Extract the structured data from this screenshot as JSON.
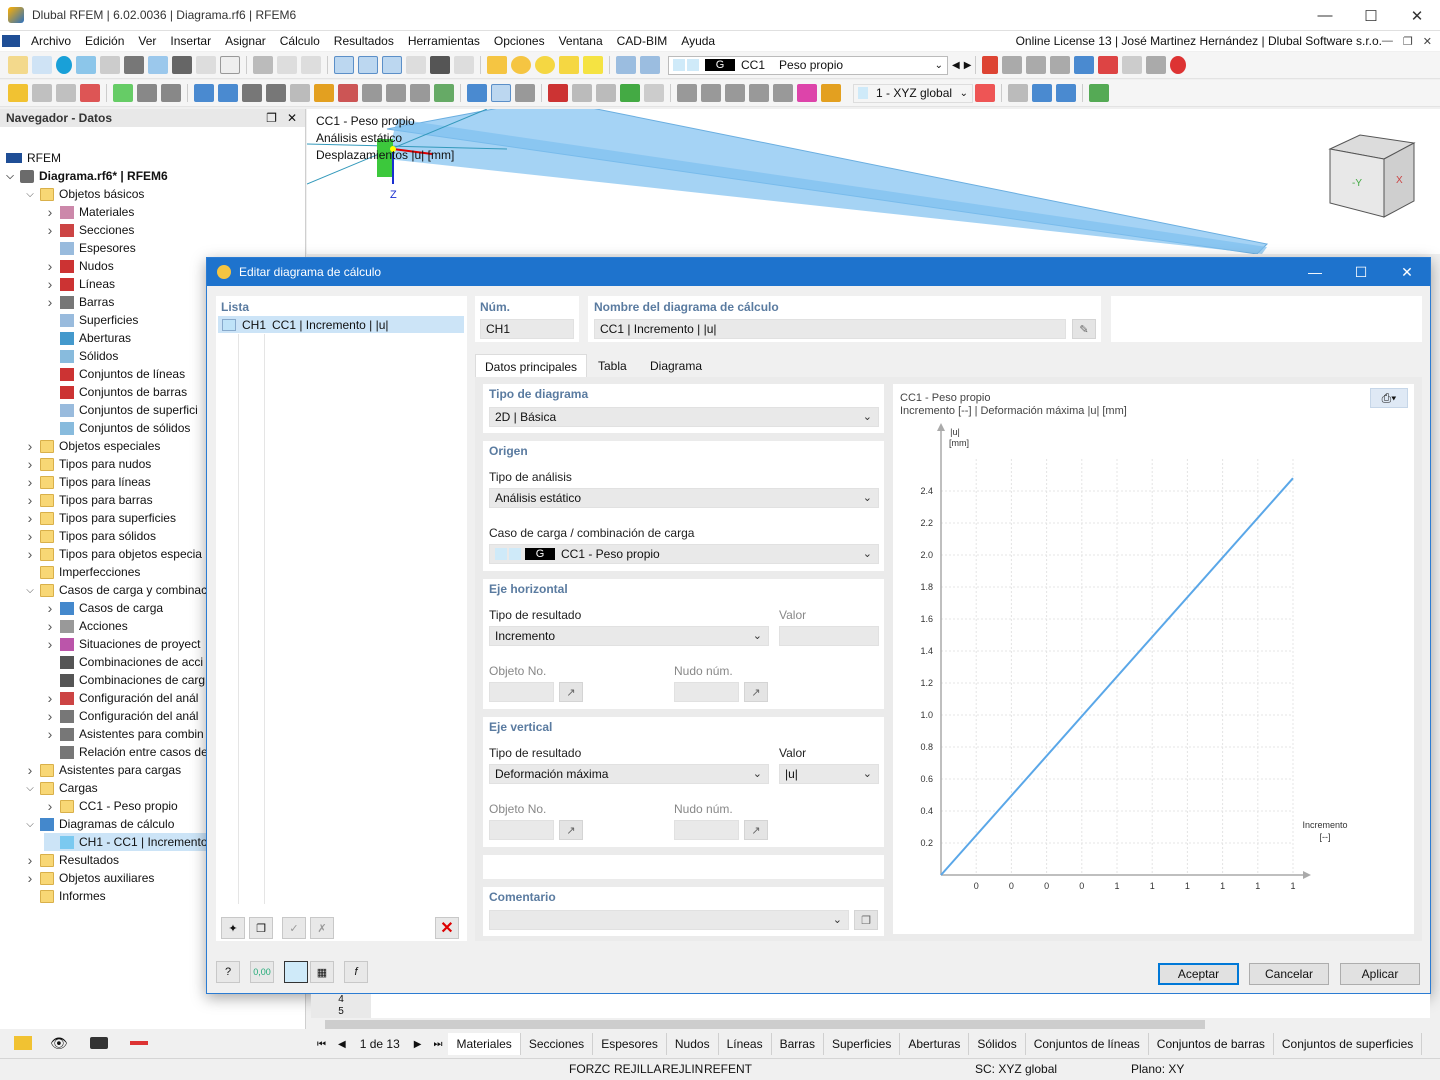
{
  "app": {
    "title": "Dlubal RFEM | 6.02.0036 | Diagrama.rf6 | RFEM6"
  },
  "menu": {
    "items": [
      "Archivo",
      "Edición",
      "Ver",
      "Insertar",
      "Asignar",
      "Cálculo",
      "Resultados",
      "Herramientas",
      "Opciones",
      "Ventana",
      "CAD-BIM",
      "Ayuda"
    ],
    "license": "Online License 13 | José Martinez Hernández | Dlubal Software s.r.o."
  },
  "toolbar": {
    "load_case_tag": "G",
    "load_case_id": "CC1",
    "load_case_name": "Peso propio",
    "coord_system": "1 - XYZ global"
  },
  "navigator": {
    "title": "Navegador - Datos",
    "root": "RFEM",
    "file": "Diagrama.rf6* | RFEM6",
    "items": [
      "Objetos básicos",
      "Materiales",
      "Secciones",
      "Espesores",
      "Nudos",
      "Líneas",
      "Barras",
      "Superficies",
      "Aberturas",
      "Sólidos",
      "Conjuntos de líneas",
      "Conjuntos de barras",
      "Conjuntos de superfici",
      "Conjuntos de sólidos",
      "Objetos especiales",
      "Tipos para nudos",
      "Tipos para líneas",
      "Tipos para barras",
      "Tipos para superficies",
      "Tipos para sólidos",
      "Tipos para objetos especia",
      "Imperfecciones",
      "Casos de carga y combinac",
      "Casos de carga",
      "Acciones",
      "Situaciones de proyect",
      "Combinaciones de acci",
      "Combinaciones de carg",
      "Configuración del anál",
      "Configuración del anál",
      "Asistentes para combin",
      "Relación entre casos de",
      "Asistentes para cargas",
      "Cargas",
      "CC1 - Peso propio",
      "Diagramas de cálculo",
      "CH1 - CC1 | Incremento",
      "Resultados",
      "Objetos auxiliares",
      "Informes"
    ]
  },
  "viewport": {
    "info": [
      "CC1 - Peso propio",
      "Análisis estático",
      "Desplazamientos |u| [mm]"
    ],
    "axis_z": "Z"
  },
  "dialog": {
    "title": "Editar diagrama de cálculo",
    "list_label": "Lista",
    "list_items": [
      {
        "id": "CH1",
        "name": "CC1 | Incremento | |u|"
      }
    ],
    "num_label": "Núm.",
    "num_value": "CH1",
    "name_label": "Nombre del diagrama de cálculo",
    "name_value": "CC1 | Incremento | |u|",
    "tabs": [
      "Datos principales",
      "Tabla",
      "Diagrama"
    ],
    "diagram_type_label": "Tipo de diagrama",
    "diagram_type_value": "2D | Básica",
    "origin_label": "Origen",
    "analysis_type_label": "Tipo de análisis",
    "analysis_type_value": "Análisis estático",
    "load_case_label": "Caso de carga / combinación de carga",
    "load_case_tag": "G",
    "load_case_value": "CC1 - Peso propio",
    "h_axis_label": "Eje horizontal",
    "result_type_label": "Tipo de resultado",
    "value_label": "Valor",
    "h_result_value": "Incremento",
    "object_no_label": "Objeto No.",
    "node_no_label": "Nudo núm.",
    "v_axis_label": "Eje vertical",
    "v_result_value": "Deformación máxima",
    "v_value": "|u|",
    "comment_label": "Comentario",
    "buttons": {
      "ok": "Aceptar",
      "cancel": "Cancelar",
      "apply": "Aplicar"
    },
    "footer_value": "0,00"
  },
  "chart_data": {
    "type": "line",
    "title": "CC1 - Peso propio",
    "subtitle": "Incremento [--] | Deformación máxima |u| [mm]",
    "ylabel_line1": "|u|",
    "ylabel_line2": "[mm]",
    "xlabel_line1": "Incremento",
    "xlabel_line2": "[--]",
    "y_ticks": [
      "0.2",
      "0.4",
      "0.6",
      "0.8",
      "1.0",
      "1.2",
      "1.4",
      "1.6",
      "1.8",
      "2.0",
      "2.2",
      "2.4"
    ],
    "x_ticks": [
      "0",
      "0",
      "0",
      "0",
      "1",
      "1",
      "1",
      "1",
      "1",
      "1"
    ],
    "ylim": [
      0,
      2.6
    ],
    "x": [
      0,
      1
    ],
    "y": [
      0,
      2.48
    ],
    "grid": true,
    "color": "#5aa7e8"
  },
  "bottom": {
    "page": "1 de 13",
    "tabs": [
      "Materiales",
      "Secciones",
      "Espesores",
      "Nudos",
      "Líneas",
      "Barras",
      "Superficies",
      "Aberturas",
      "Sólidos",
      "Conjuntos de líneas",
      "Conjuntos de barras",
      "Conjuntos de superficies"
    ],
    "rows": [
      "4",
      "5"
    ]
  },
  "status": {
    "items": [
      "FORZC",
      "REJILLA",
      "REJLIN",
      "REFENT"
    ],
    "cs": "SC: XYZ global",
    "plane": "Plano: XY"
  }
}
